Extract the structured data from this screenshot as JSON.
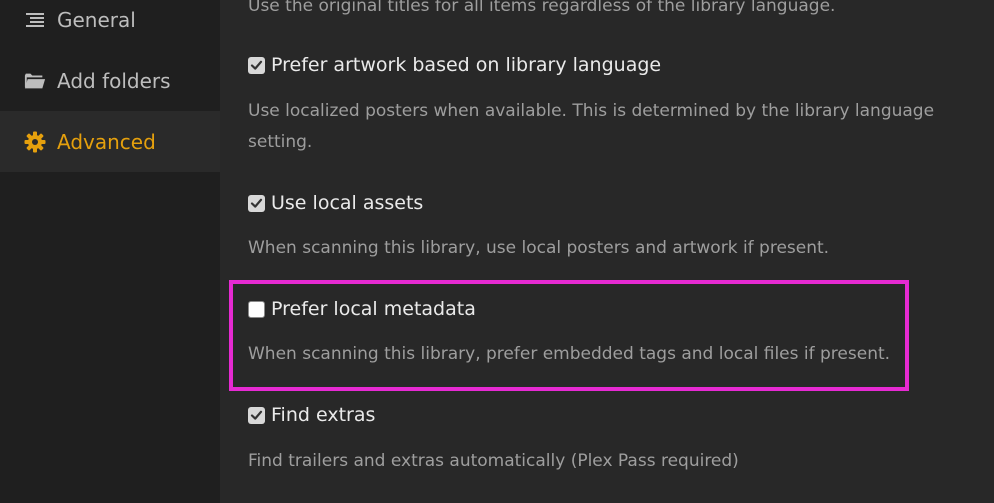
{
  "sidebar": {
    "items": [
      {
        "label": "General",
        "icon": "list-icon",
        "active": false
      },
      {
        "label": "Add folders",
        "icon": "folder-icon",
        "active": false
      },
      {
        "label": "Advanced",
        "icon": "gear-icon",
        "active": true
      }
    ]
  },
  "colors": {
    "accent": "#e5a00d",
    "highlight": "#e62ad2",
    "background": "#282828",
    "sidebar": "#1f1f1f"
  },
  "options": {
    "original_titles_desc": "Use the original titles for all items regardless of the library language.",
    "prefer_artwork": {
      "label": "Prefer artwork based on library language",
      "checked": true,
      "desc": "Use localized posters when available. This is determined by the library language setting."
    },
    "local_assets": {
      "label": "Use local assets",
      "checked": true,
      "desc": "When scanning this library, use local posters and artwork if present."
    },
    "local_metadata": {
      "label": "Prefer local metadata",
      "checked": false,
      "desc": "When scanning this library, prefer embedded tags and local files if present."
    },
    "find_extras": {
      "label": "Find extras",
      "checked": true,
      "desc": "Find trailers and extras automatically (Plex Pass required)"
    }
  }
}
